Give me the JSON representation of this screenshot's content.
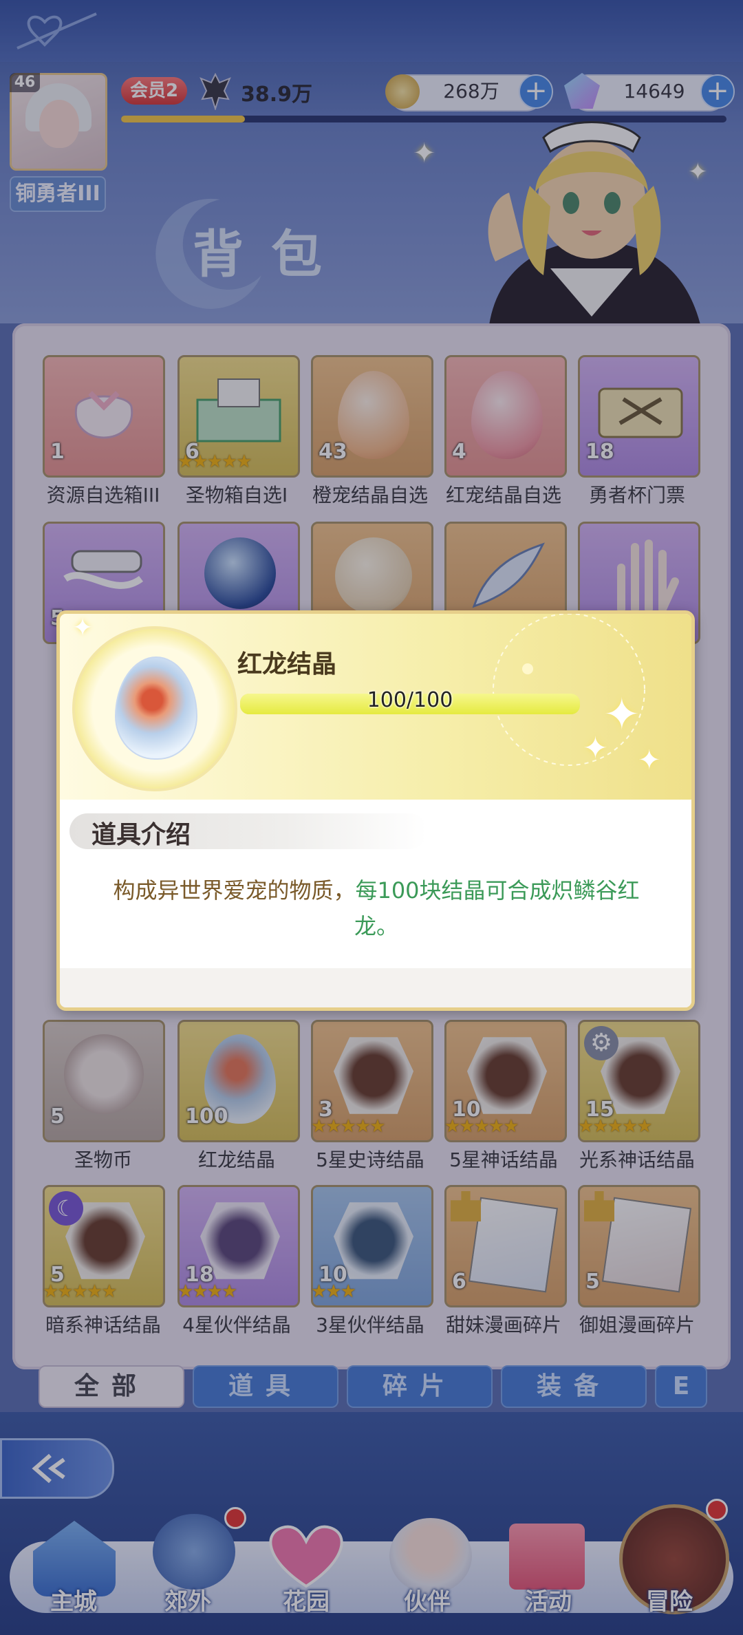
{
  "header": {
    "level": "46",
    "rank": "铜勇者III",
    "vip": "会员2",
    "power": "38.9万",
    "gold": "268万",
    "diamonds": "14649",
    "plus_glyph": "+"
  },
  "page_title": "背包",
  "items_row1": [
    {
      "count": "1",
      "name": "资源自选箱III",
      "quality": "red",
      "stars": ""
    },
    {
      "count": "6",
      "name": "圣物箱自选I",
      "quality": "yellow",
      "stars": "★★★★★"
    },
    {
      "count": "43",
      "name": "橙宠结晶自选",
      "quality": "orange",
      "stars": ""
    },
    {
      "count": "4",
      "name": "红宠结晶自选",
      "quality": "red",
      "stars": ""
    },
    {
      "count": "18",
      "name": "勇者杯门票",
      "quality": "purple",
      "stars": ""
    }
  ],
  "items_row2": [
    {
      "count": "5",
      "quality": "purple"
    },
    {
      "count": "",
      "quality": "purple"
    },
    {
      "count": "",
      "quality": "orange"
    },
    {
      "count": "",
      "quality": "orange"
    },
    {
      "count": "",
      "quality": "purple"
    }
  ],
  "items_row5": [
    {
      "count": "5",
      "name": "圣物币",
      "quality": "gray",
      "stars": ""
    },
    {
      "count": "100",
      "name": "红龙结晶",
      "quality": "yellow",
      "stars": ""
    },
    {
      "count": "3",
      "name": "5星史诗结晶",
      "quality": "orange",
      "stars": "★★★★★"
    },
    {
      "count": "10",
      "name": "5星神话结晶",
      "quality": "orange",
      "stars": "★★★★★"
    },
    {
      "count": "15",
      "name": "光系神话结晶",
      "quality": "yellow",
      "stars": "★★★★★"
    }
  ],
  "items_row6": [
    {
      "count": "5",
      "name": "暗系神话结晶",
      "quality": "yellow",
      "stars": "★★★★★"
    },
    {
      "count": "18",
      "name": "4星伙伴结晶",
      "quality": "purple",
      "stars": "★★★★"
    },
    {
      "count": "10",
      "name": "3星伙伴结晶",
      "quality": "blue",
      "stars": "★★★"
    },
    {
      "count": "6",
      "name": "甜妹漫画碎片",
      "quality": "orange",
      "stars": ""
    },
    {
      "count": "5",
      "name": "御姐漫画碎片",
      "quality": "orange",
      "stars": ""
    }
  ],
  "tabs": [
    "全部",
    "道具",
    "碎片",
    "装备",
    "E"
  ],
  "nav": [
    "主城",
    "郊外",
    "花园",
    "伙伴",
    "活动",
    "冒险"
  ],
  "modal": {
    "item_name": "红龙结晶",
    "progress_text": "100/100",
    "progress": 1.0,
    "section_title": "道具介绍",
    "desc_part1": "构成异世界爱宠的物质，",
    "desc_part2": "每100块结晶可合成炽鳞谷红龙。"
  },
  "colors": {
    "accent_green": "#3b9a58",
    "desc_brown": "#7a5a2a",
    "modal_border": "#e6cf8a"
  }
}
